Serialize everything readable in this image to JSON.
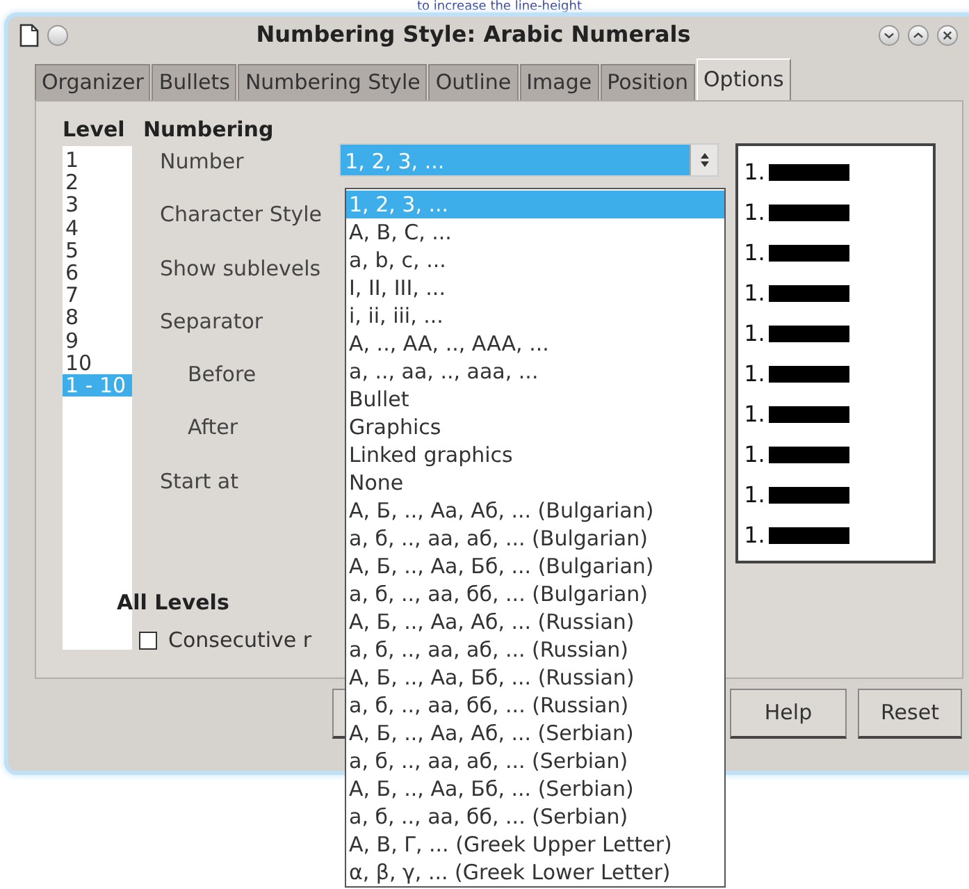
{
  "background_text": "to increase the line-height",
  "window": {
    "title": "Numbering Style: Arabic Numerals"
  },
  "tabs": [
    {
      "label": "Organizer",
      "selected": false
    },
    {
      "label": "Bullets",
      "selected": false
    },
    {
      "label": "Numbering Style",
      "selected": false
    },
    {
      "label": "Outline",
      "selected": false
    },
    {
      "label": "Image",
      "selected": false
    },
    {
      "label": "Position",
      "selected": false
    },
    {
      "label": "Options",
      "selected": true
    }
  ],
  "level": {
    "heading": "Level",
    "items": [
      {
        "label": "1",
        "selected": false
      },
      {
        "label": "2",
        "selected": false
      },
      {
        "label": "3",
        "selected": false
      },
      {
        "label": "4",
        "selected": false
      },
      {
        "label": "5",
        "selected": false
      },
      {
        "label": "6",
        "selected": false
      },
      {
        "label": "7",
        "selected": false
      },
      {
        "label": "8",
        "selected": false
      },
      {
        "label": "9",
        "selected": false
      },
      {
        "label": "10",
        "selected": false
      },
      {
        "label": "1 - 10",
        "selected": true
      }
    ]
  },
  "numbering": {
    "heading": "Numbering",
    "fields": [
      {
        "label": "Number",
        "kind": "main",
        "value": "1, 2, 3, ..."
      },
      {
        "label": "Character Style",
        "kind": "main"
      },
      {
        "label": "Show sublevels",
        "kind": "main"
      },
      {
        "label": "Separator",
        "kind": "main"
      },
      {
        "label": "Before",
        "kind": "sub"
      },
      {
        "label": "After",
        "kind": "sub"
      },
      {
        "label": "Start at",
        "kind": "main"
      }
    ]
  },
  "preview": {
    "lines": [
      {
        "number": "1."
      },
      {
        "number": "1."
      },
      {
        "number": "1."
      },
      {
        "number": "1."
      },
      {
        "number": "1."
      },
      {
        "number": "1."
      },
      {
        "number": "1."
      },
      {
        "number": "1."
      },
      {
        "number": "1."
      },
      {
        "number": "1."
      }
    ]
  },
  "all_levels": {
    "heading": "All Levels",
    "checkbox": {
      "label": "Consecutive r",
      "checked": false
    }
  },
  "buttons": [
    {
      "kind": "covered"
    },
    {
      "kind": "text",
      "label": "Help"
    },
    {
      "kind": "text",
      "label": "Reset"
    }
  ],
  "dropdown": {
    "options": [
      {
        "label": "1, 2, 3, ...",
        "selected": true
      },
      {
        "label": "A, B, C, ...",
        "selected": false
      },
      {
        "label": "a, b, c, ...",
        "selected": false
      },
      {
        "label": "I, II, III, ...",
        "selected": false
      },
      {
        "label": "i, ii, iii, ...",
        "selected": false
      },
      {
        "label": "A, .., AA, .., AAA, ...",
        "selected": false
      },
      {
        "label": "a, .., aa, .., aaa, ...",
        "selected": false
      },
      {
        "label": "Bullet",
        "selected": false
      },
      {
        "label": "Graphics",
        "selected": false
      },
      {
        "label": "Linked graphics",
        "selected": false
      },
      {
        "label": "None",
        "selected": false
      },
      {
        "label": "А, Б, .., Аа, Аб, ... (Bulgarian)",
        "selected": false
      },
      {
        "label": "а, б, .., аа, аб, ... (Bulgarian)",
        "selected": false
      },
      {
        "label": "А, Б, .., Аа, Бб, ... (Bulgarian)",
        "selected": false
      },
      {
        "label": "а, б, .., аа, бб, ... (Bulgarian)",
        "selected": false
      },
      {
        "label": "А, Б, .., Аа, Аб, ... (Russian)",
        "selected": false
      },
      {
        "label": "а, б, .., аа, аб, ... (Russian)",
        "selected": false
      },
      {
        "label": "А, Б, .., Аа, Бб, ... (Russian)",
        "selected": false
      },
      {
        "label": "а, б, .., аа, бб, ... (Russian)",
        "selected": false
      },
      {
        "label": "А, Б, .., Аа, Аб, ... (Serbian)",
        "selected": false
      },
      {
        "label": "а, б, .., аа, аб, ... (Serbian)",
        "selected": false
      },
      {
        "label": "А, Б, .., Аа, Бб, ... (Serbian)",
        "selected": false
      },
      {
        "label": "а, б, .., аа, бб, ... (Serbian)",
        "selected": false
      },
      {
        "label": "Α, Β, Γ, ... (Greek Upper Letter)",
        "selected": false
      },
      {
        "label": "α, β, γ, ... (Greek Lower Letter)",
        "selected": false
      }
    ]
  }
}
